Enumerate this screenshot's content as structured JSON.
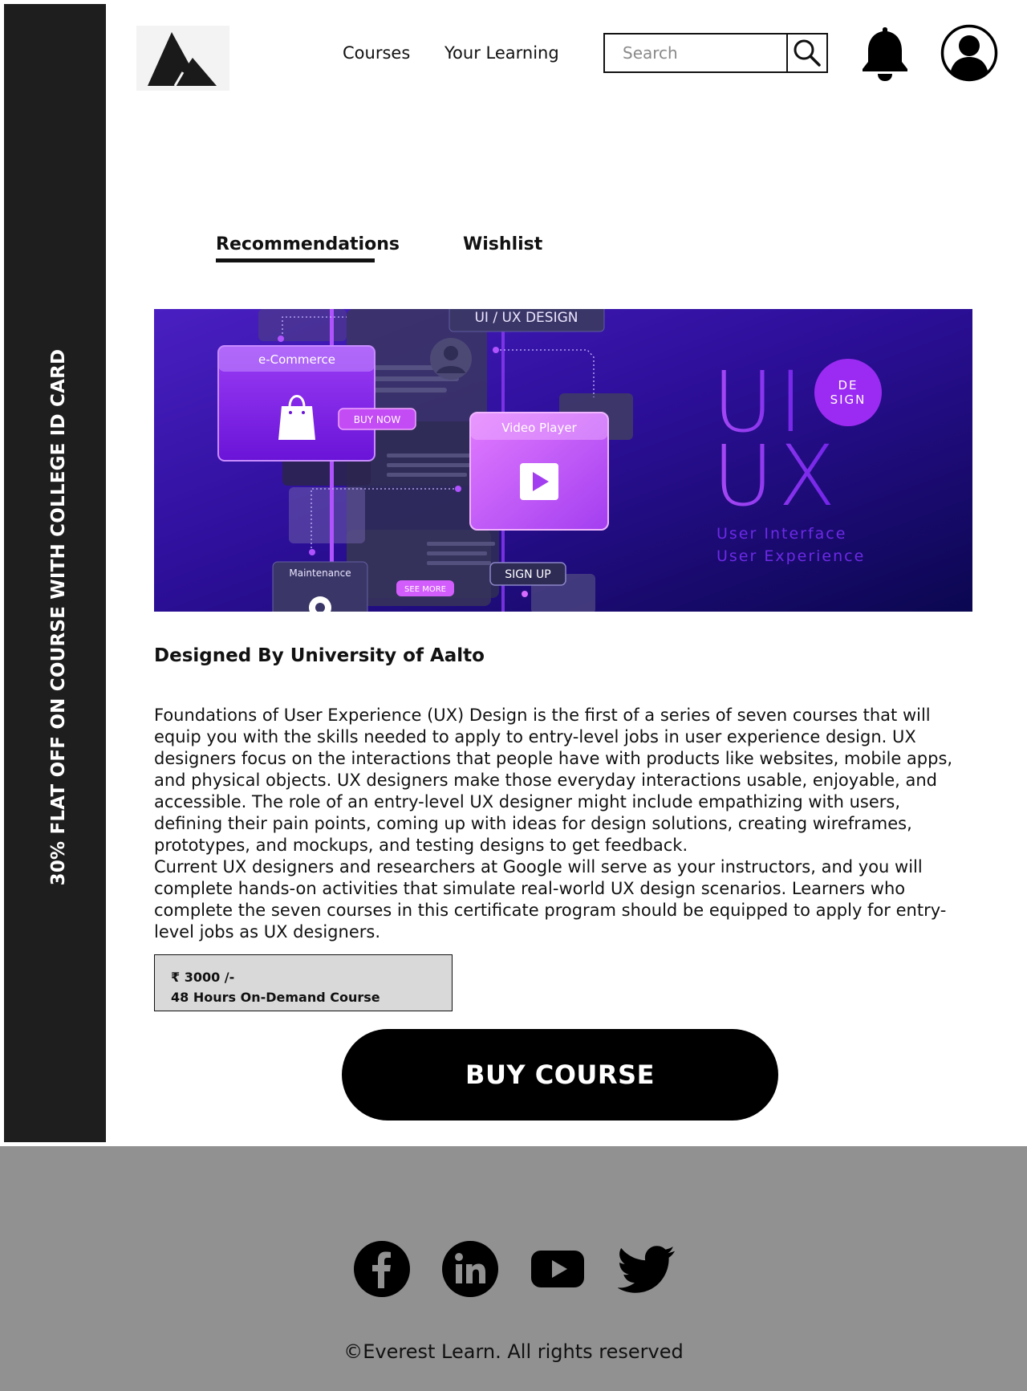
{
  "promo": {
    "text": "30% FLAT OFF ON COURSE WITH COLLEGE ID CARD"
  },
  "header": {
    "nav": [
      "Courses",
      "Your Learning"
    ],
    "search": {
      "placeholder": "Search",
      "value": ""
    }
  },
  "tabs": {
    "items": [
      "Recommendations",
      "Wishlist"
    ],
    "active": "Recommendations"
  },
  "banner": {
    "title_tag": "UI / UX DESIGN",
    "card_ecommerce": "e-Commerce",
    "buy_now": "BUY NOW",
    "video_player": "Video Player",
    "maintenance": "Maintenance",
    "see_more": "SEE MORE",
    "sign_up": "SIGN UP",
    "big_ui": "UI",
    "big_ux": "UX",
    "badge": [
      "DE",
      "SIGN"
    ],
    "subtitle_1": "User Interface",
    "subtitle_2": "User Experience"
  },
  "course": {
    "designed_by": "Designed By University of Aalto",
    "description_1": "Foundations of User Experience (UX) Design is the first of a series of seven courses that will equip you with the skills needed to apply to entry-level jobs in user experience design. UX designers focus on the interactions that people have with products like websites, mobile apps, and physical objects. UX designers make those everyday interactions usable, enjoyable, and accessible. The role of an entry-level UX designer might include empathizing with users, defining their pain points, coming up with ideas for design solutions, creating wireframes, prototypes, and mockups, and testing designs to get feedback.",
    "description_2": "Current UX designers and researchers at Google will serve as your instructors, and you will complete hands-on activities that simulate real-world UX design scenarios. Learners who complete the seven courses in this certificate program should be equipped to apply for entry-level jobs as UX designers.",
    "price": "₹ 3000 /-",
    "duration": "48 Hours On-Demand Course",
    "buy_label": "BUY COURSE"
  },
  "footer": {
    "social_icons": [
      "facebook-icon",
      "linkedin-icon",
      "youtube-icon",
      "twitter-icon"
    ],
    "copyright": "©Everest Learn. All rights reserved"
  },
  "colors": {
    "sidebar": "#1e1e1e",
    "footer": "#919191",
    "banner_bg": "#2a0f8a",
    "accent_purple": "#8a2be2",
    "price_box": "#d9d9d9"
  }
}
